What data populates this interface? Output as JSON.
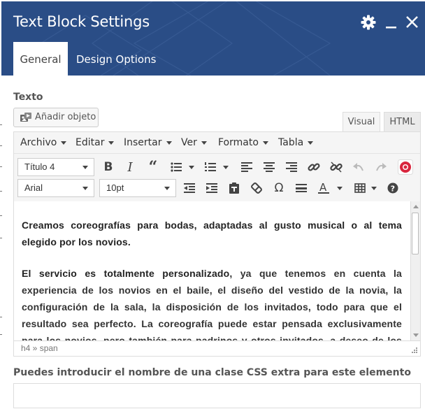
{
  "header": {
    "title": "Text Block Settings",
    "bg_color": "#2a4d86",
    "icons": [
      "gear-icon",
      "minimize-icon",
      "close-icon"
    ],
    "tabs": [
      {
        "label": "General",
        "active": true
      },
      {
        "label": "Design Options",
        "active": false
      }
    ]
  },
  "body": {
    "texto_label": "Texto",
    "add_object_label": "Añadir objeto",
    "editor_tabs": {
      "visual": "Visual",
      "html": "HTML"
    },
    "menu": [
      "Archivo",
      "Editar",
      "Insertar",
      "Ver",
      "Formato",
      "Tabla"
    ],
    "format_select": "Título 4",
    "font_select": "Arial",
    "size_select": "10pt",
    "toolbar_row1_icons": [
      "bold-icon",
      "italic-icon",
      "blockquote-icon",
      "bullet-list-icon",
      "numbered-list-icon",
      "align-left-icon",
      "align-center-icon",
      "align-right-icon",
      "link-icon",
      "unlink-icon",
      "undo-icon",
      "redo-icon",
      "lifebuoy-icon"
    ],
    "toolbar_row2_icons": [
      "outdent-icon",
      "indent-icon",
      "paste-text-icon",
      "clear-format-icon",
      "omega-icon",
      "horizontal-rule-icon",
      "text-color-icon",
      "table-icon",
      "help-icon"
    ],
    "content": {
      "p1": "Creamos coreografías para bodas, adaptadas al gusto musical o al tema elegido por los novios.",
      "p2_bold": "El servicio es totalmente personalizado",
      "p2_rest": ", ya que tenemos en cuenta la experiencia de los novios en el baile, el diseño del vestido de la novia, la configuración de la sala, la disposición de los invitados, todo para que el resultado sea perfecto. La coreografía puede estar pensada exclusivamente para los novios, pero también para padrinos y otros invitados, a deseo de los interesados."
    },
    "status_path": "h4 » span",
    "css_label": "Puedes introducir el nombre de una clase CSS extra para este elemento",
    "css_value": ""
  }
}
